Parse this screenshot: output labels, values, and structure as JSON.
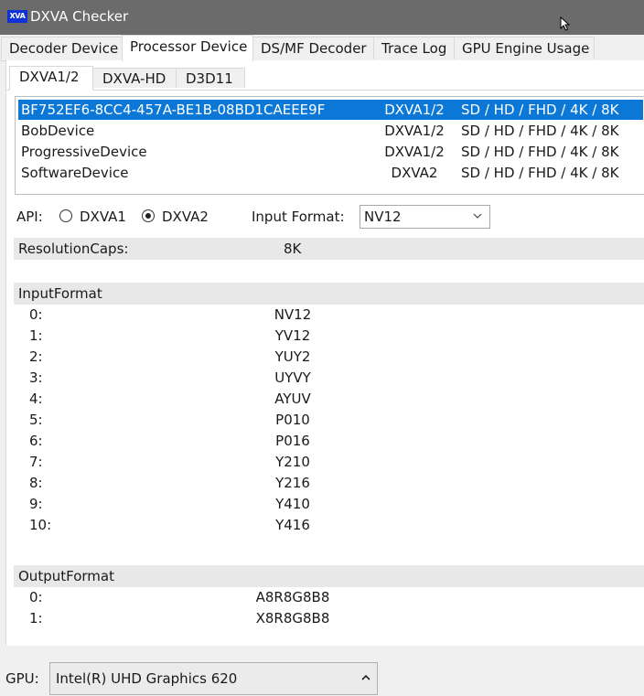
{
  "window": {
    "icon_text": "XVA",
    "title": "DXVA Checker"
  },
  "main_tabs": [
    "Decoder Device",
    "Processor Device",
    "DS/MF Decoder",
    "Trace Log",
    "GPU Engine Usage"
  ],
  "sub_tabs": [
    "DXVA1/2",
    "DXVA-HD",
    "D3D11"
  ],
  "devices": [
    {
      "name": "BF752EF6-8CC4-457A-BE1B-08BD1CAEEE9F",
      "api": "DXVA1/2",
      "res": "SD / HD / FHD / 4K / 8K"
    },
    {
      "name": "BobDevice",
      "api": "DXVA1/2",
      "res": "SD / HD / FHD / 4K / 8K"
    },
    {
      "name": "ProgressiveDevice",
      "api": "DXVA1/2",
      "res": "SD / HD / FHD / 4K / 8K"
    },
    {
      "name": "SoftwareDevice",
      "api": "DXVA2",
      "res": "SD / HD / FHD / 4K / 8K"
    }
  ],
  "api": {
    "label": "API:",
    "option1": "DXVA1",
    "option2": "DXVA2",
    "input_format_label": "Input Format:",
    "input_format_value": "NV12"
  },
  "resolution_caps": {
    "label": "ResolutionCaps:",
    "value": "8K"
  },
  "input_format": {
    "header": "InputFormat",
    "rows": [
      {
        "k": "0:",
        "v": "NV12"
      },
      {
        "k": "1:",
        "v": "YV12"
      },
      {
        "k": "2:",
        "v": "YUY2"
      },
      {
        "k": "3:",
        "v": "UYVY"
      },
      {
        "k": "4:",
        "v": "AYUV"
      },
      {
        "k": "5:",
        "v": "P010"
      },
      {
        "k": "6:",
        "v": "P016"
      },
      {
        "k": "7:",
        "v": "Y210"
      },
      {
        "k": "8:",
        "v": "Y216"
      },
      {
        "k": "9:",
        "v": "Y410"
      },
      {
        "k": "10:",
        "v": "Y416"
      }
    ]
  },
  "output_format": {
    "header": "OutputFormat",
    "rows": [
      {
        "k": "0:",
        "v": "A8R8G8B8"
      },
      {
        "k": "1:",
        "v": "X8R8G8B8"
      }
    ]
  },
  "gpu": {
    "label": "GPU:",
    "value": "Intel(R) UHD Graphics 620"
  },
  "colors": {
    "selection": "#0b78d7",
    "titlebar": "#6b6b6b"
  }
}
